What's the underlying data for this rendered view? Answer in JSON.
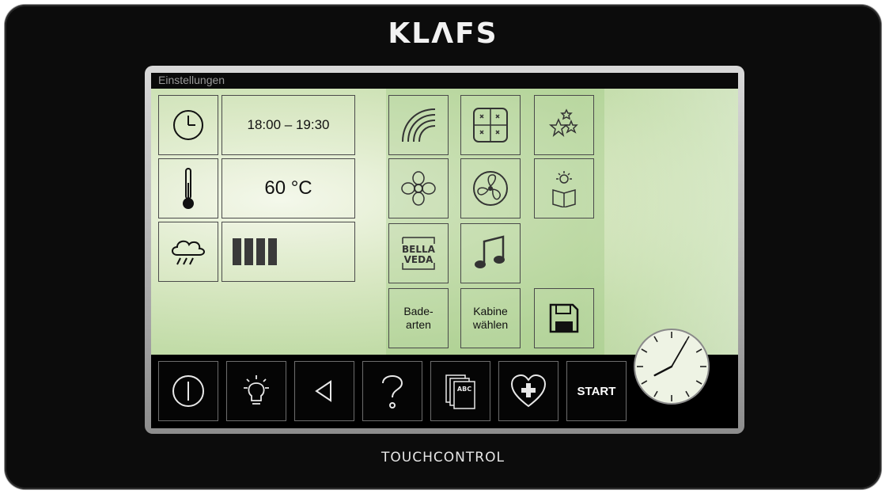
{
  "brand": "KLΛFS",
  "footer": "TOUCHCONTROL",
  "screen": {
    "title": "Einstellungen",
    "time_range": "18:00 – 19:30",
    "temperature": "60 °C",
    "humidity_bars_filled": 4,
    "badearten_line1": "Bade-",
    "badearten_line2": "arten",
    "kabine_line1": "Kabine",
    "kabine_line2": "wählen",
    "bella_line1": "BELLA",
    "bella_line2": "VEDA",
    "start_label": "START",
    "abc_label": "ABC",
    "clock_time": "20:05"
  },
  "colors": {
    "bezel": "#0c0c0c",
    "screen_bg": "#cfe2b5",
    "tile_border": "#4a4a4a",
    "toolbar_bg": "#050505"
  }
}
